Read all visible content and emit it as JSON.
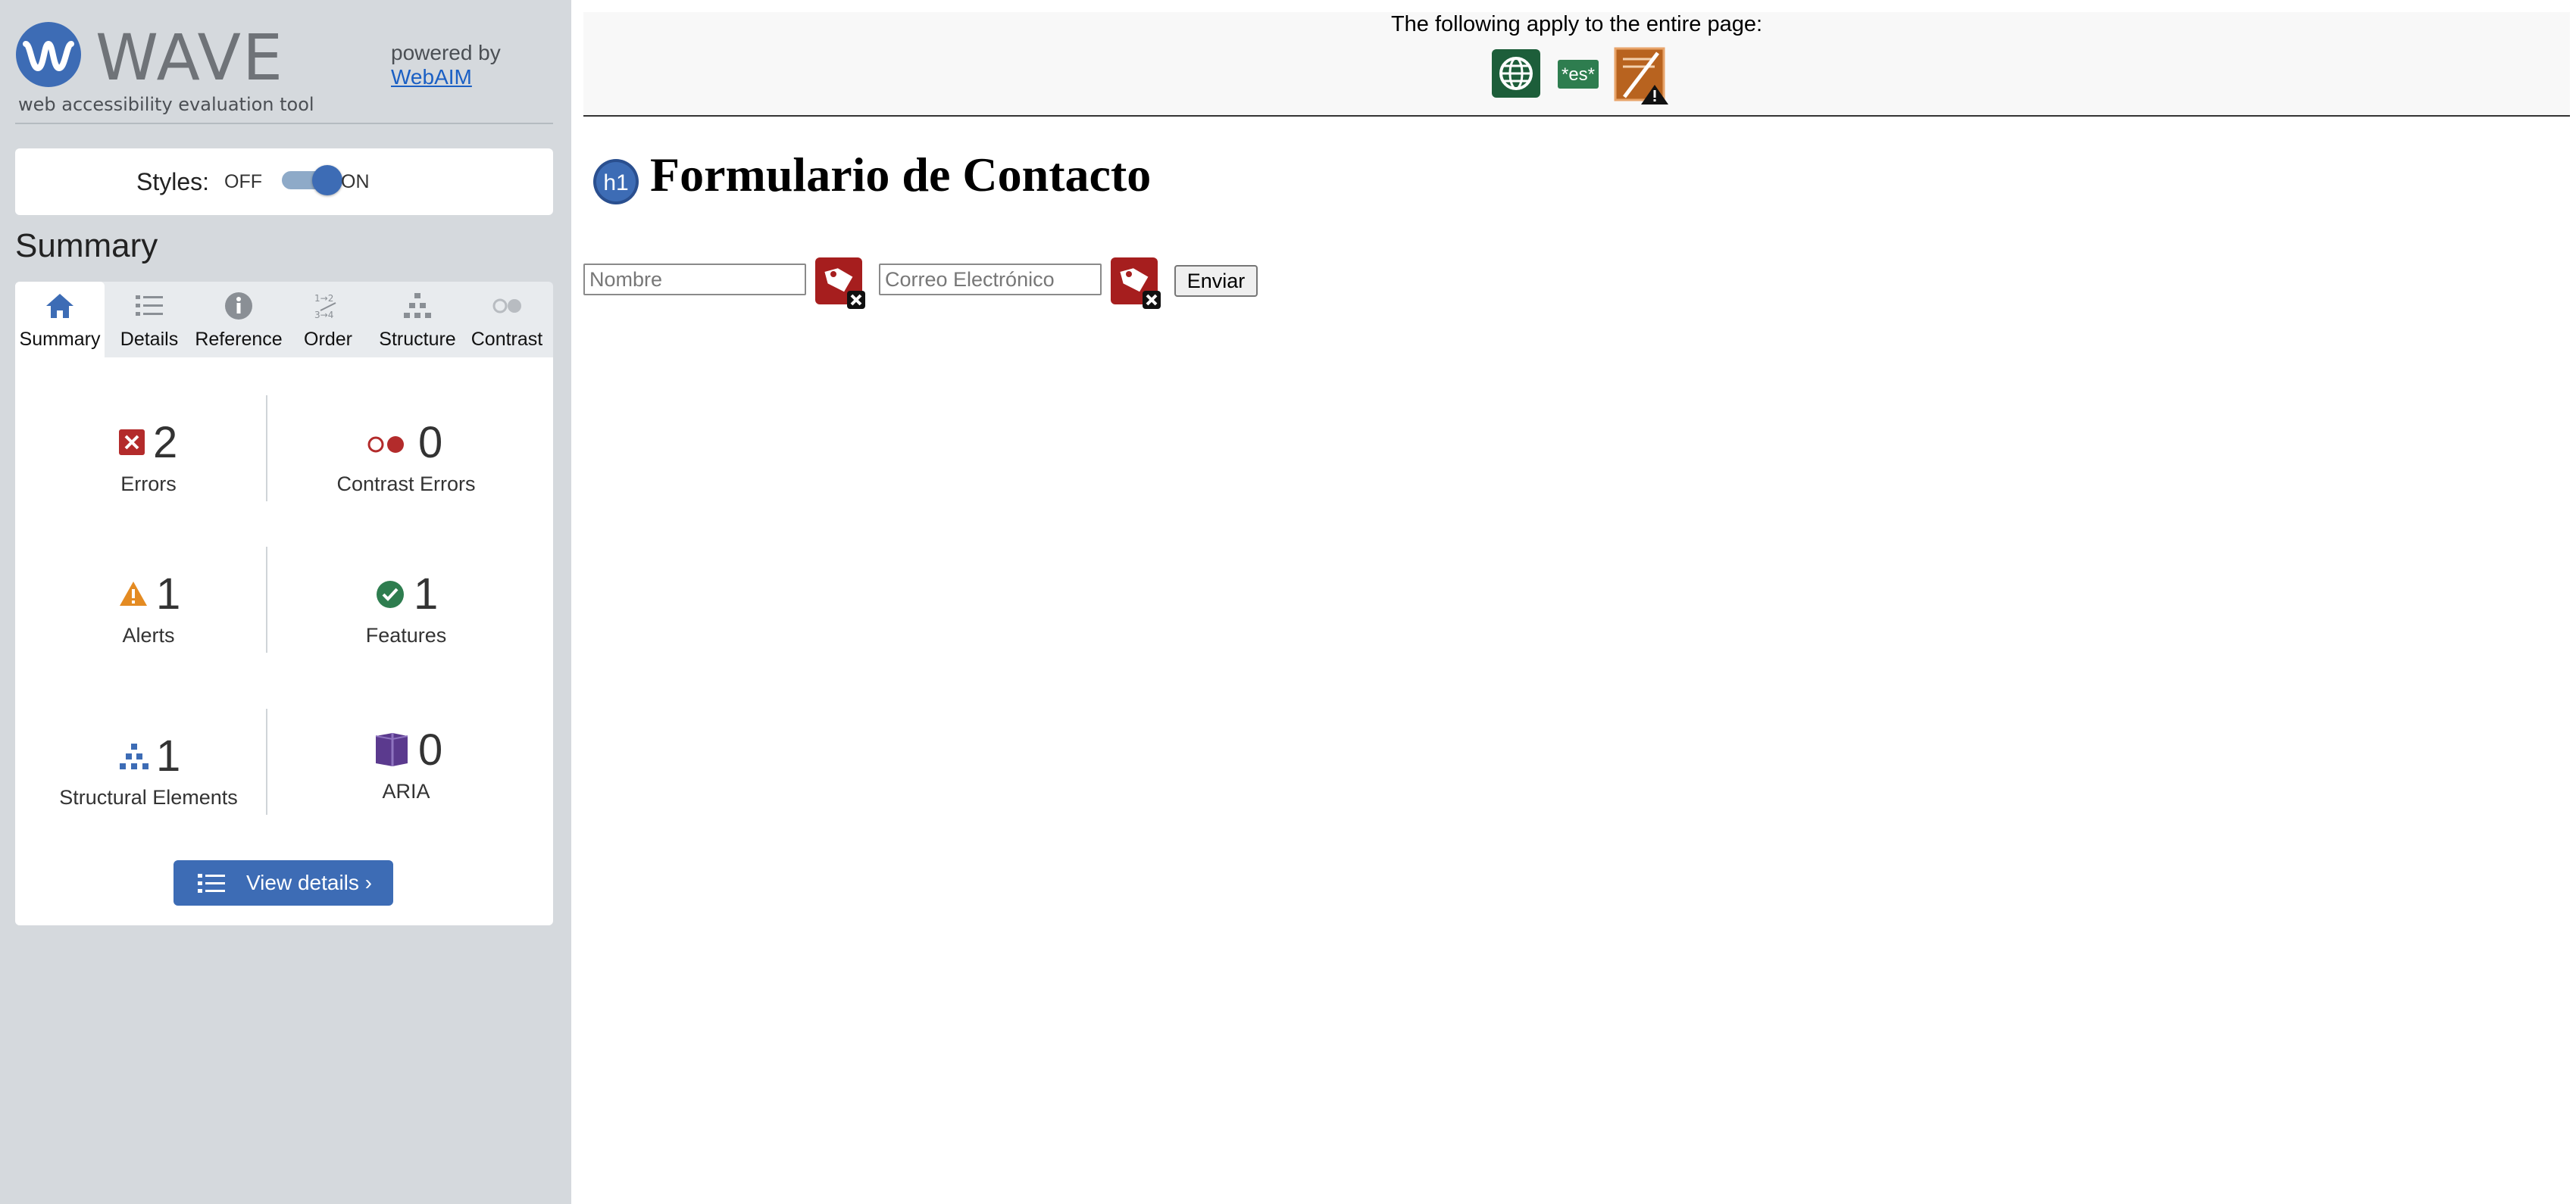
{
  "brand": {
    "name": "WAVE",
    "tagline": "web accessibility evaluation tool",
    "powered_by": "powered by",
    "webaim_link": "WebAIM"
  },
  "styles": {
    "label": "Styles:",
    "off": "OFF",
    "on": "ON",
    "enabled": true
  },
  "summary": {
    "heading": "Summary",
    "tabs": [
      {
        "label": "Summary",
        "icon": "home-icon",
        "active": true
      },
      {
        "label": "Details",
        "icon": "list-icon"
      },
      {
        "label": "Reference",
        "icon": "info-icon"
      },
      {
        "label": "Order",
        "icon": "order-icon"
      },
      {
        "label": "Structure",
        "icon": "structure-icon"
      },
      {
        "label": "Contrast",
        "icon": "contrast-icon"
      }
    ],
    "stats": {
      "errors": {
        "count": "2",
        "label": "Errors"
      },
      "contrast_errors": {
        "count": "0",
        "label": "Contrast Errors"
      },
      "alerts": {
        "count": "1",
        "label": "Alerts"
      },
      "features": {
        "count": "1",
        "label": "Features"
      },
      "structural": {
        "count": "1",
        "label": "Structural Elements"
      },
      "aria": {
        "count": "0",
        "label": "ARIA"
      }
    },
    "view_details": "View details ›"
  },
  "colors": {
    "accent_blue": "#3d6cb5",
    "error_red": "#b32b2b",
    "alert_orange": "#e48b22",
    "feature_green": "#2e7d4f",
    "aria_purple": "#5b3a8e"
  },
  "page": {
    "banner_text": "The following apply to the entire page:",
    "banner_icons": [
      "globe-icon",
      "language-es-icon",
      "document-alert-icon"
    ],
    "language_badge": "*es*",
    "h1_badge": "h1",
    "heading": "Formulario de Contacto",
    "form": {
      "name_placeholder": "Nombre",
      "email_placeholder": "Correo Electrónico",
      "submit_label": "Enviar"
    }
  }
}
